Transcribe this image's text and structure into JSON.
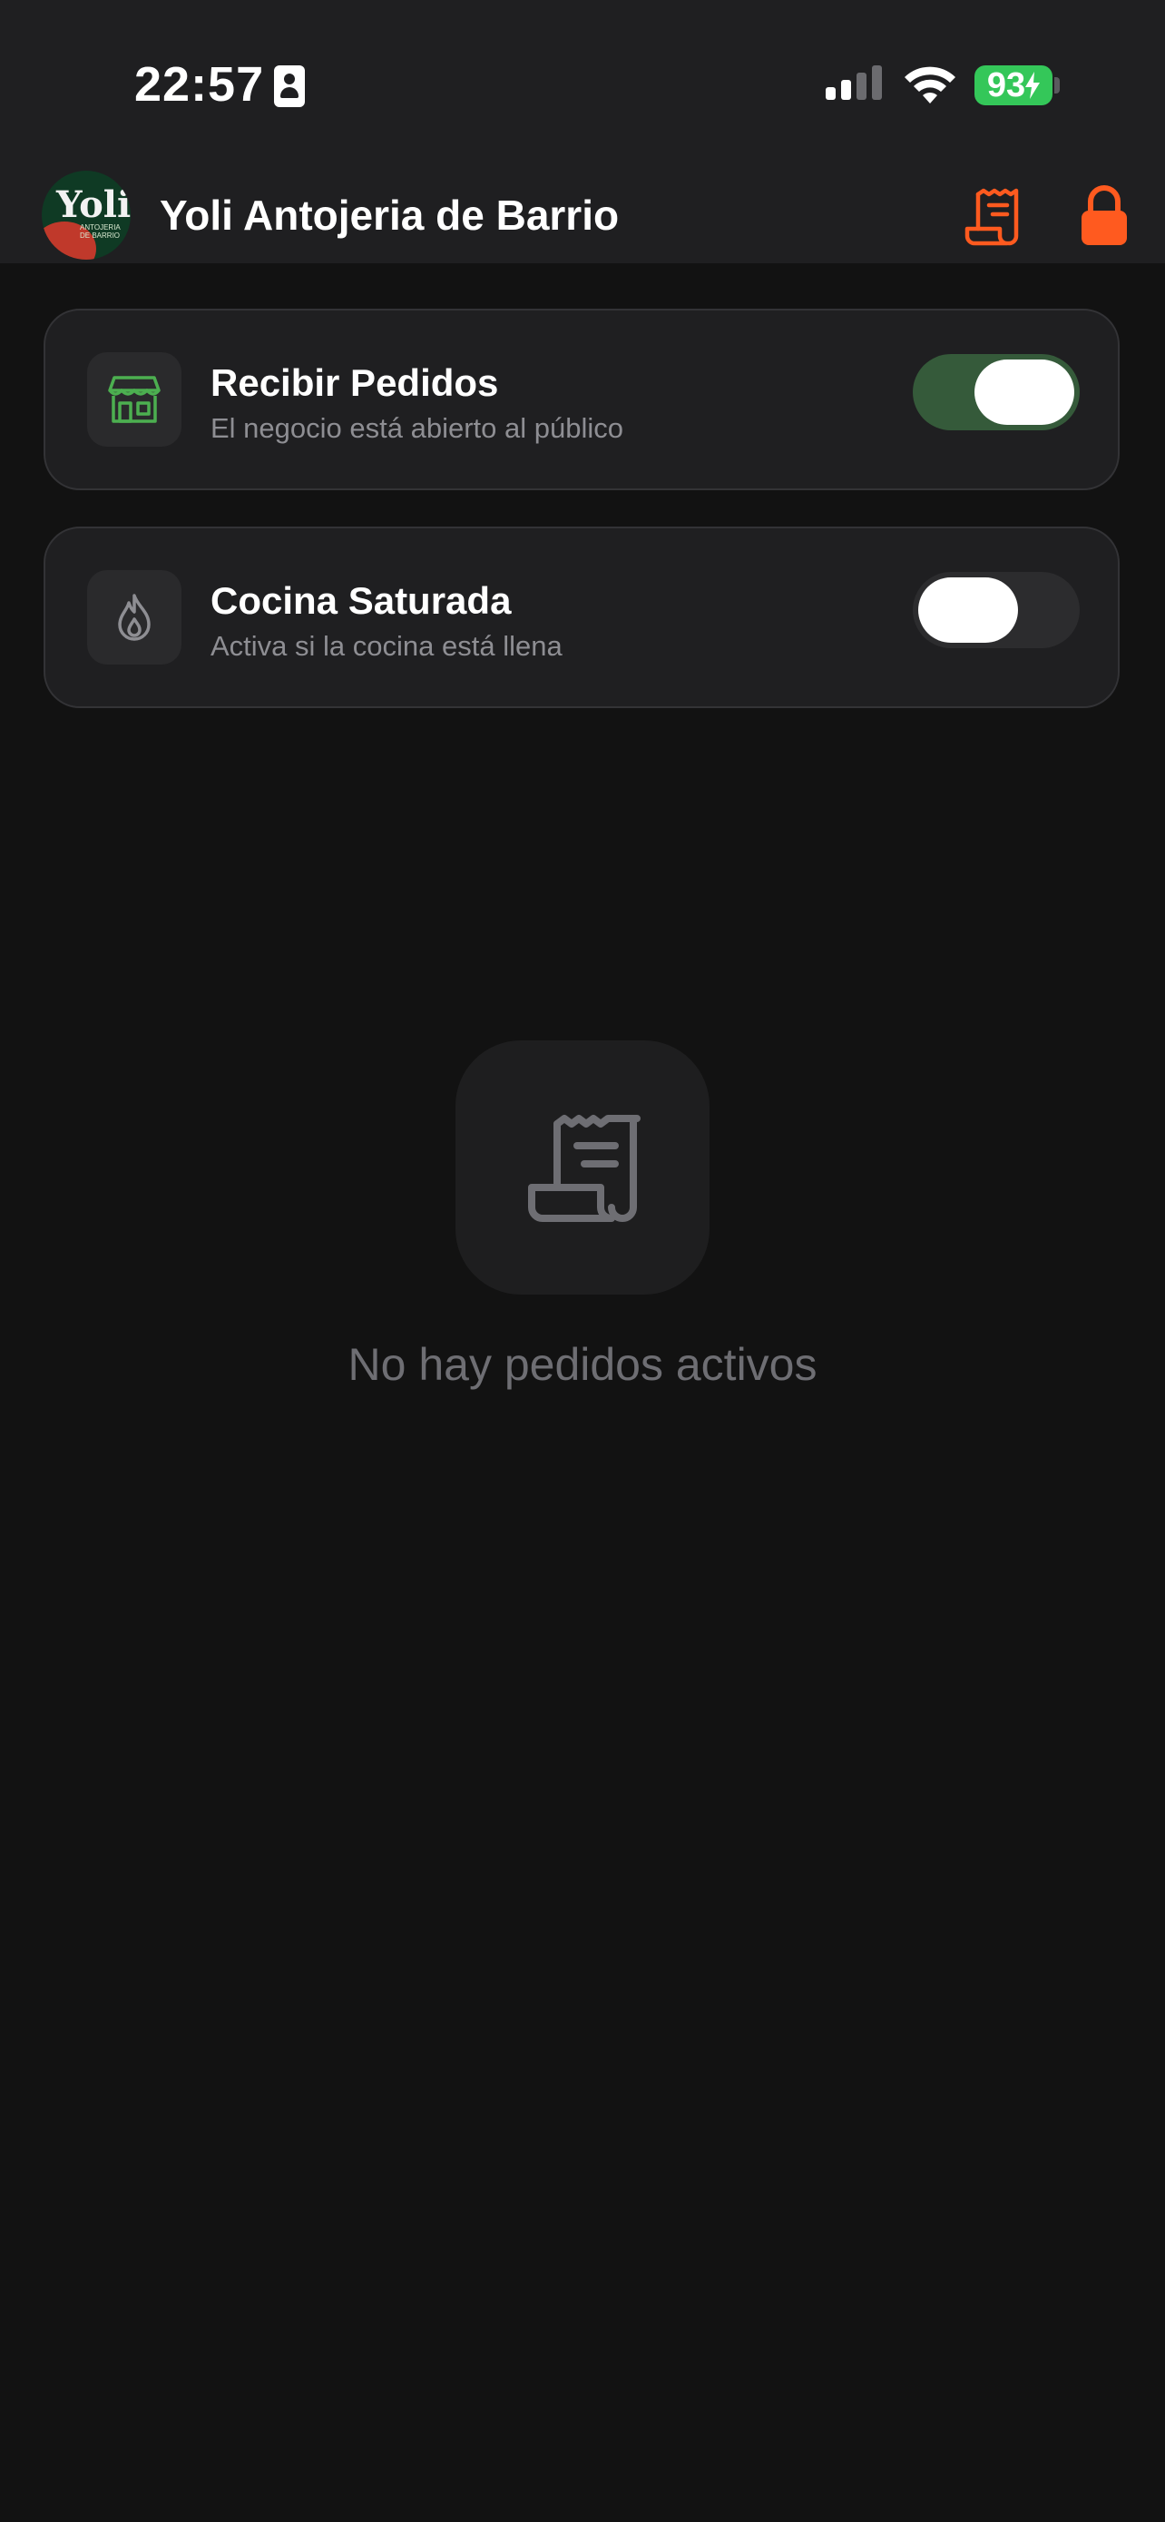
{
  "status_bar": {
    "time": "22:57",
    "battery": "93"
  },
  "header": {
    "shop_name": "Yoli Antojeria de Barrio",
    "logo_text": "Yoli",
    "logo_subtext": "ANTOJERIA DE BARRIO"
  },
  "toggles": [
    {
      "title": "Recibir Pedidos",
      "subtitle": "El negocio está abierto al público",
      "on": true,
      "icon": "store-icon"
    },
    {
      "title": "Cocina Saturada",
      "subtitle": "Activa si la cocina está llena",
      "on": false,
      "icon": "flame-icon"
    }
  ],
  "empty_state": {
    "message": "No hay pedidos activos",
    "icon": "receipt-icon"
  },
  "colors": {
    "accent": "#ff5a1f",
    "toggle_on": "#355a3a",
    "store_icon": "#4caf50",
    "battery": "#34c759"
  }
}
